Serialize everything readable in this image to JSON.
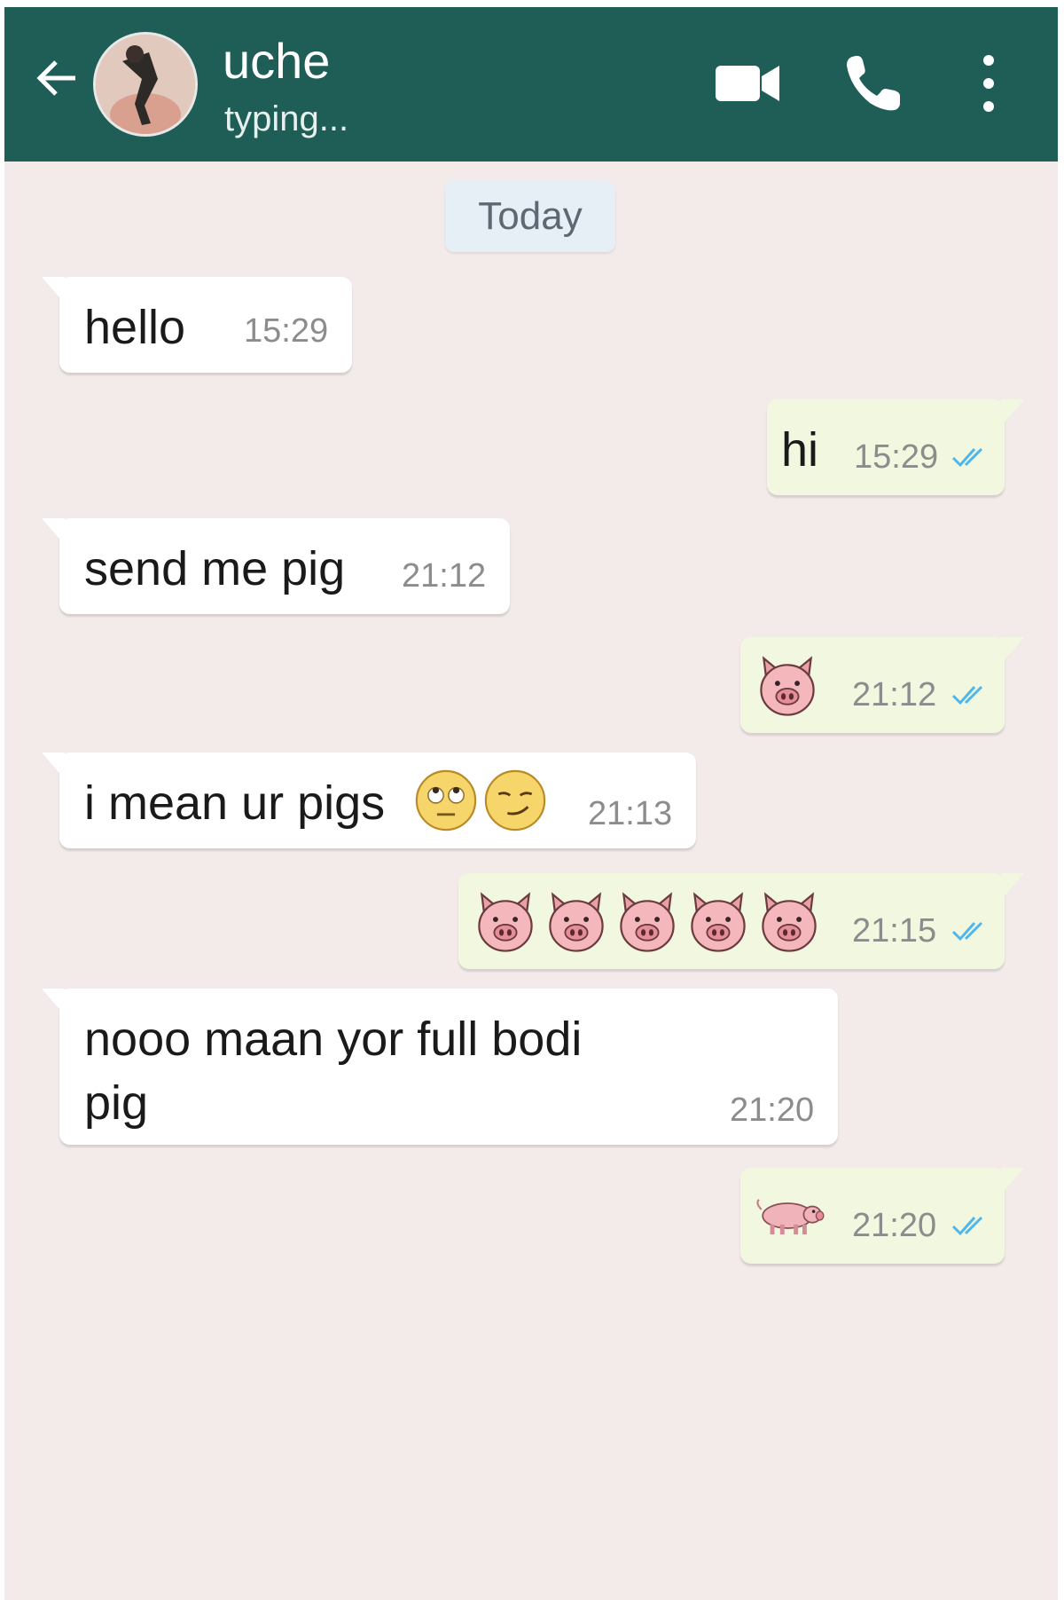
{
  "header": {
    "contact_name": "uche",
    "status": "typing...",
    "icons": [
      "back-arrow-icon",
      "avatar",
      "video-call-icon",
      "phone-icon",
      "more-options-icon"
    ],
    "color": "#1f5e56"
  },
  "date_chip": "Today",
  "messages": [
    {
      "direction": "incoming",
      "text": "hello",
      "time": "15:29"
    },
    {
      "direction": "outgoing",
      "text": "hi",
      "time": "15:29",
      "status": "read"
    },
    {
      "direction": "incoming",
      "text": "send me pig",
      "time": "21:12"
    },
    {
      "direction": "outgoing",
      "emoji": [
        "pig-face"
      ],
      "time": "21:12",
      "status": "read"
    },
    {
      "direction": "incoming",
      "text": "i mean ur pigs",
      "emoji": [
        "face-with-rolling-eyes",
        "smirking-face"
      ],
      "time": "21:13"
    },
    {
      "direction": "outgoing",
      "emoji": [
        "pig-face",
        "pig-face",
        "pig-face",
        "pig-face",
        "pig-face"
      ],
      "time": "21:15",
      "status": "read"
    },
    {
      "direction": "incoming",
      "text_line1": "nooo maan yor full bodi",
      "text_line2": "pig",
      "time": "21:20"
    },
    {
      "direction": "outgoing",
      "emoji": [
        "pig"
      ],
      "time": "21:20",
      "status": "read"
    }
  ],
  "colors": {
    "chat_background": "#f3ebe9",
    "incoming_bubble": "#ffffff",
    "outgoing_bubble": "#f2f8e0",
    "read_ticks": "#4fb6ec"
  }
}
